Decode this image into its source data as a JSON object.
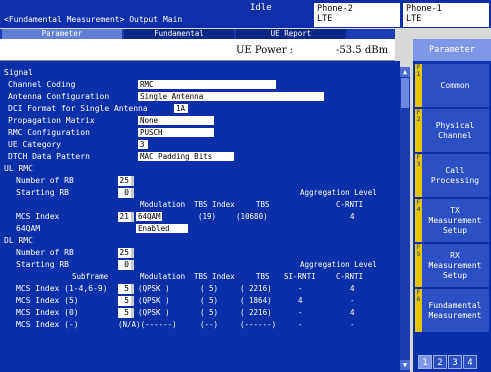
{
  "header": {
    "status": "Idle",
    "title": "<Fundamental Measurement> Output Main",
    "phone2_line1": "Phone-2",
    "phone2_line2": "LTE",
    "phone1_line1": "Phone-1",
    "phone1_line2": "LTE"
  },
  "tabs": [
    "Parameter",
    "Fundamental",
    "UE Report"
  ],
  "power": {
    "label": "UE Power :",
    "value": "-53.5 dBm"
  },
  "signal": {
    "header": "Signal",
    "channel_coding_label": "Channel Coding",
    "channel_coding": "RMC",
    "antenna_label": "Antenna Configuration",
    "antenna": "Single Antenna",
    "dci_label": "DCI Format for Single Antenna",
    "dci": "1A",
    "propagation_label": "Propagation Matrix",
    "propagation": "None",
    "rmc_conf_label": "RMC Configuration",
    "rmc_conf": "PUSCH",
    "ue_cat_label": "UE Category",
    "ue_cat": "3",
    "dtch_label": "DTCH Data Pattern",
    "dtch": "MAC Padding Bits"
  },
  "ul_rmc": {
    "header": "UL RMC",
    "num_rb_label": "Number of RB",
    "num_rb": "25",
    "start_rb_label": "Starting RB",
    "start_rb": "0",
    "agg_label": "Aggregation Level",
    "col_mod": "Modulation",
    "col_tbs_index": "TBS Index",
    "col_tbs": "TBS",
    "col_crnti": "C-RNTI",
    "mcs_label": "MCS Index",
    "mcs": "21",
    "mod": "64QAM",
    "tbs_index": "(19)",
    "tbs": "(10680)",
    "crnti": "4",
    "qam_label": "64QAM",
    "qam": "Enabled"
  },
  "dl_rmc": {
    "header": "DL RMC",
    "num_rb_label": "Number of RB",
    "num_rb": "25",
    "start_rb_label": "Starting RB",
    "start_rb": "0",
    "agg_label": "Aggregation Level",
    "col_subframe": "Subframe",
    "col_mod": "Modulation",
    "col_tbs_index": "TBS Index",
    "col_tbs": "TBS",
    "col_sirnti": "SI-RNTI",
    "col_crnti": "C-RNTI",
    "rows": [
      {
        "label": "MCS Index (1-4,6-9)",
        "mcs": "5",
        "mod": "(QPSK )",
        "tbs_index": "( 5)",
        "tbs": "( 2216)",
        "sirnti": "-",
        "crnti": "4"
      },
      {
        "label": "MCS Index (5)",
        "mcs": "5",
        "mod": "(QPSK )",
        "tbs_index": "( 5)",
        "tbs": "( 1864)",
        "sirnti": "4",
        "crnti": "-"
      },
      {
        "label": "MCS Index (0)",
        "mcs": "5",
        "mod": "(QPSK )",
        "tbs_index": "( 5)",
        "tbs": "( 2216)",
        "sirnti": "-",
        "crnti": "4"
      },
      {
        "label": "MCS Index (-)",
        "mcs": "",
        "mod": "(N/A)(------)",
        "tbs_index": "(--)",
        "tbs": "(------)",
        "sirnti": "-",
        "crnti": "-"
      }
    ]
  },
  "sidebar": {
    "title": "Parameter",
    "buttons": [
      {
        "num": "F 1",
        "label": "Common"
      },
      {
        "num": "F 2",
        "label": "Physical Channel"
      },
      {
        "num": "F 3",
        "label": "Call Processing"
      },
      {
        "num": "F 4",
        "label": "TX Measurement Setup"
      },
      {
        "num": "F 5",
        "label": "RX Measurement Setup"
      },
      {
        "num": "F 6",
        "label": "Fundamental Measurement"
      }
    ],
    "pages": [
      "1",
      "2",
      "3",
      "4"
    ]
  },
  "colors": {
    "panel_blue": "#0b2fa8",
    "accent_yellow": "#e6c400",
    "highlight": "#7c96e8"
  }
}
